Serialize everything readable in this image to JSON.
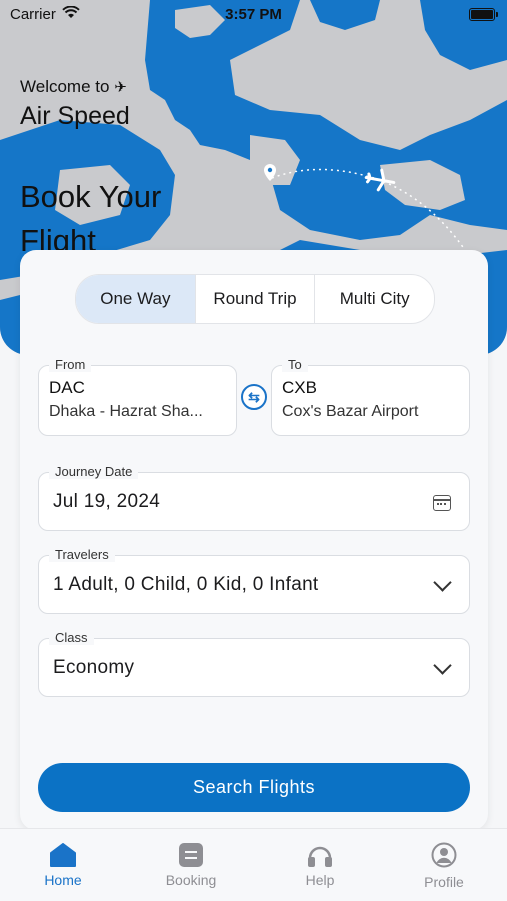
{
  "status_bar": {
    "carrier": "Carrier",
    "time": "3:57 PM"
  },
  "header": {
    "welcome": "Welcome to",
    "app_name": "Air Speed",
    "headline": "Book Your Flight"
  },
  "trip_types": {
    "one_way": "One Way",
    "round_trip": "Round Trip",
    "multi_city": "Multi City",
    "selected": "One Way"
  },
  "from": {
    "label": "From",
    "code": "DAC",
    "airport": "Dhaka - Hazrat Sha..."
  },
  "to": {
    "label": "To",
    "code": "CXB",
    "airport": "Cox's Bazar Airport"
  },
  "journey_date": {
    "label": "Journey Date",
    "value": "Jul 19, 2024"
  },
  "travelers": {
    "label": "Travelers",
    "value": "1 Adult, 0 Child, 0 Kid, 0 Infant"
  },
  "class": {
    "label": "Class",
    "value": "Economy"
  },
  "search_button": "Search Flights",
  "tabs": {
    "home": "Home",
    "booking": "Booking",
    "help": "Help",
    "profile": "Profile",
    "active": "Home"
  },
  "colors": {
    "accent": "#0b72c5",
    "map_water": "#1576c8",
    "map_land": "#c9cacd",
    "card": "#f7f8fa"
  },
  "icons": [
    "wifi-icon",
    "battery-icon",
    "plane-icon",
    "location-pin-icon",
    "swap-icon",
    "calendar-icon",
    "chevron-down-icon",
    "home-icon",
    "booking-icon",
    "headphones-icon",
    "profile-icon"
  ]
}
